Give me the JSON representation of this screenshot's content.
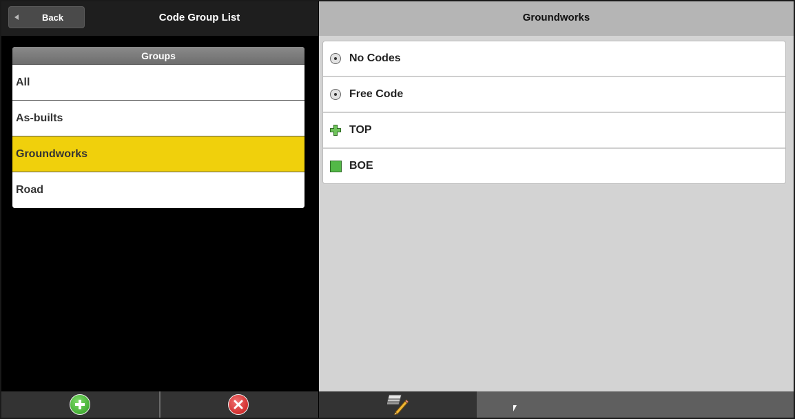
{
  "left": {
    "back_label": "Back",
    "title": "Code Group List",
    "groups_header": "Groups",
    "groups": [
      {
        "label": "All",
        "selected": false
      },
      {
        "label": "As-builts",
        "selected": false
      },
      {
        "label": "Groundworks",
        "selected": true
      },
      {
        "label": "Road",
        "selected": false
      }
    ],
    "footer": {
      "add_icon": "add-icon",
      "delete_icon": "delete-icon"
    }
  },
  "right": {
    "title": "Groundworks",
    "codes": [
      {
        "label": "No Codes",
        "icon": "radio-dot-icon"
      },
      {
        "label": "Free Code",
        "icon": "radio-dot-icon"
      },
      {
        "label": "TOP",
        "icon": "green-plus-icon"
      },
      {
        "label": "BOE",
        "icon": "green-square-icon"
      }
    ],
    "footer": {
      "edit_icon": "edit-codes-icon"
    }
  },
  "colors": {
    "selected_row": "#f0d00c",
    "add_button": "#2b9a1e",
    "delete_button": "#c51515",
    "code_icon_green": "#53b847"
  }
}
